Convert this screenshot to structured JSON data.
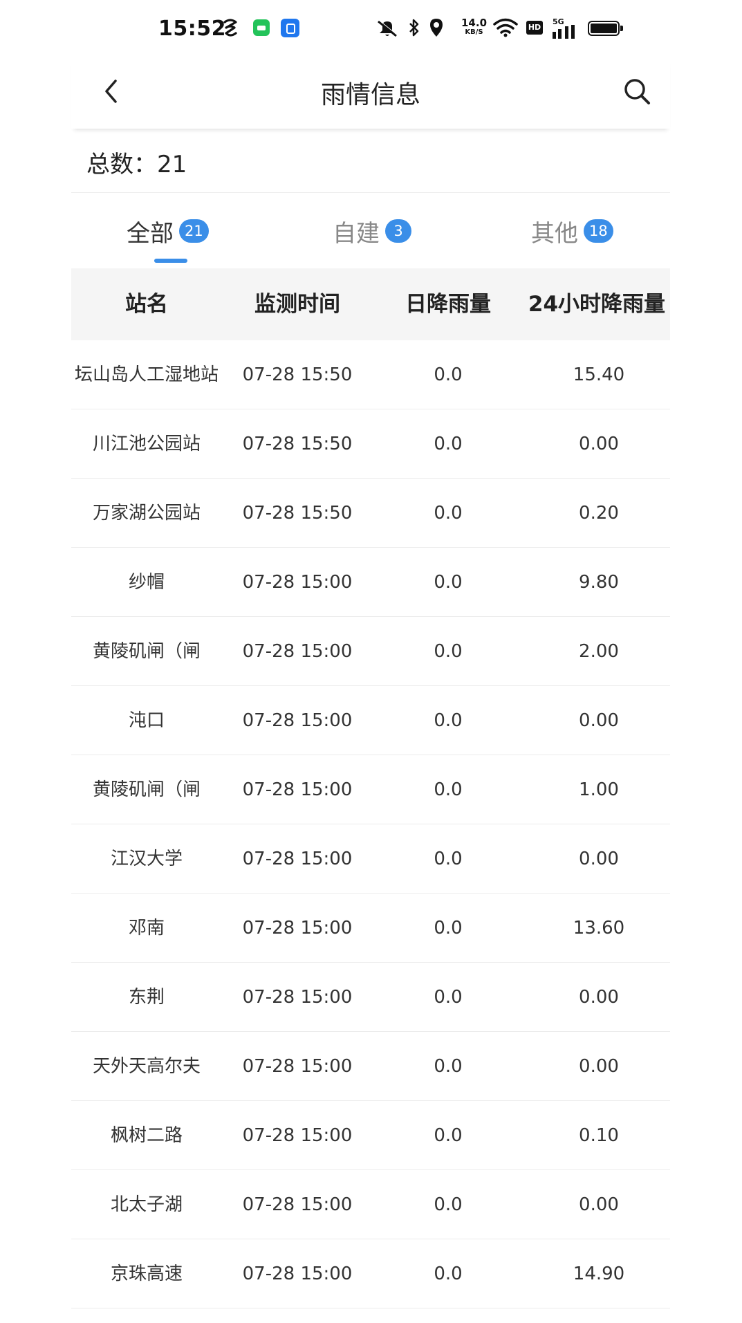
{
  "status_bar": {
    "time": "15:52",
    "net_speed_value": "14.0",
    "net_speed_unit": "KB/S",
    "hd_label": "HD",
    "network_label": "5G",
    "icons": [
      "nfc-icon",
      "app-green-icon",
      "app-blue-icon",
      "mute-icon",
      "bluetooth-icon",
      "location-icon",
      "wifi-icon",
      "signal-icon",
      "battery-icon"
    ]
  },
  "nav": {
    "title": "雨情信息",
    "back_icon": "chevron-left-icon",
    "search_icon": "search-icon"
  },
  "summary": {
    "total_text": "总数：21"
  },
  "tabs": [
    {
      "label": "全部",
      "count": "21",
      "active": true
    },
    {
      "label": "自建",
      "count": "3",
      "active": false
    },
    {
      "label": "其他",
      "count": "18",
      "active": false
    }
  ],
  "table": {
    "headers": [
      "站名",
      "监测时间",
      "日降雨量",
      "24小时降雨量"
    ],
    "rows": [
      [
        "坛山岛人工湿地站",
        "07-28 15:50",
        "0.0",
        "15.40"
      ],
      [
        "川江池公园站",
        "07-28 15:50",
        "0.0",
        "0.00"
      ],
      [
        "万家湖公园站",
        "07-28 15:50",
        "0.0",
        "0.20"
      ],
      [
        "纱帽",
        "07-28 15:00",
        "0.0",
        "9.80"
      ],
      [
        "黄陵矶闸（闸",
        "07-28 15:00",
        "0.0",
        "2.00"
      ],
      [
        "沌口",
        "07-28 15:00",
        "0.0",
        "0.00"
      ],
      [
        "黄陵矶闸（闸",
        "07-28 15:00",
        "0.0",
        "1.00"
      ],
      [
        "江汉大学",
        "07-28 15:00",
        "0.0",
        "0.00"
      ],
      [
        "邓南",
        "07-28 15:00",
        "0.0",
        "13.60"
      ],
      [
        "东荆",
        "07-28 15:00",
        "0.0",
        "0.00"
      ],
      [
        "天外天高尔夫",
        "07-28 15:00",
        "0.0",
        "0.00"
      ],
      [
        "枫树二路",
        "07-28 15:00",
        "0.0",
        "0.10"
      ],
      [
        "北太子湖",
        "07-28 15:00",
        "0.0",
        "0.00"
      ],
      [
        "京珠高速",
        "07-28 15:00",
        "0.0",
        "14.90"
      ]
    ]
  },
  "colors": {
    "accent": "#3a8ee8",
    "header_bg": "#f5f5f5",
    "divider": "#ececec"
  }
}
